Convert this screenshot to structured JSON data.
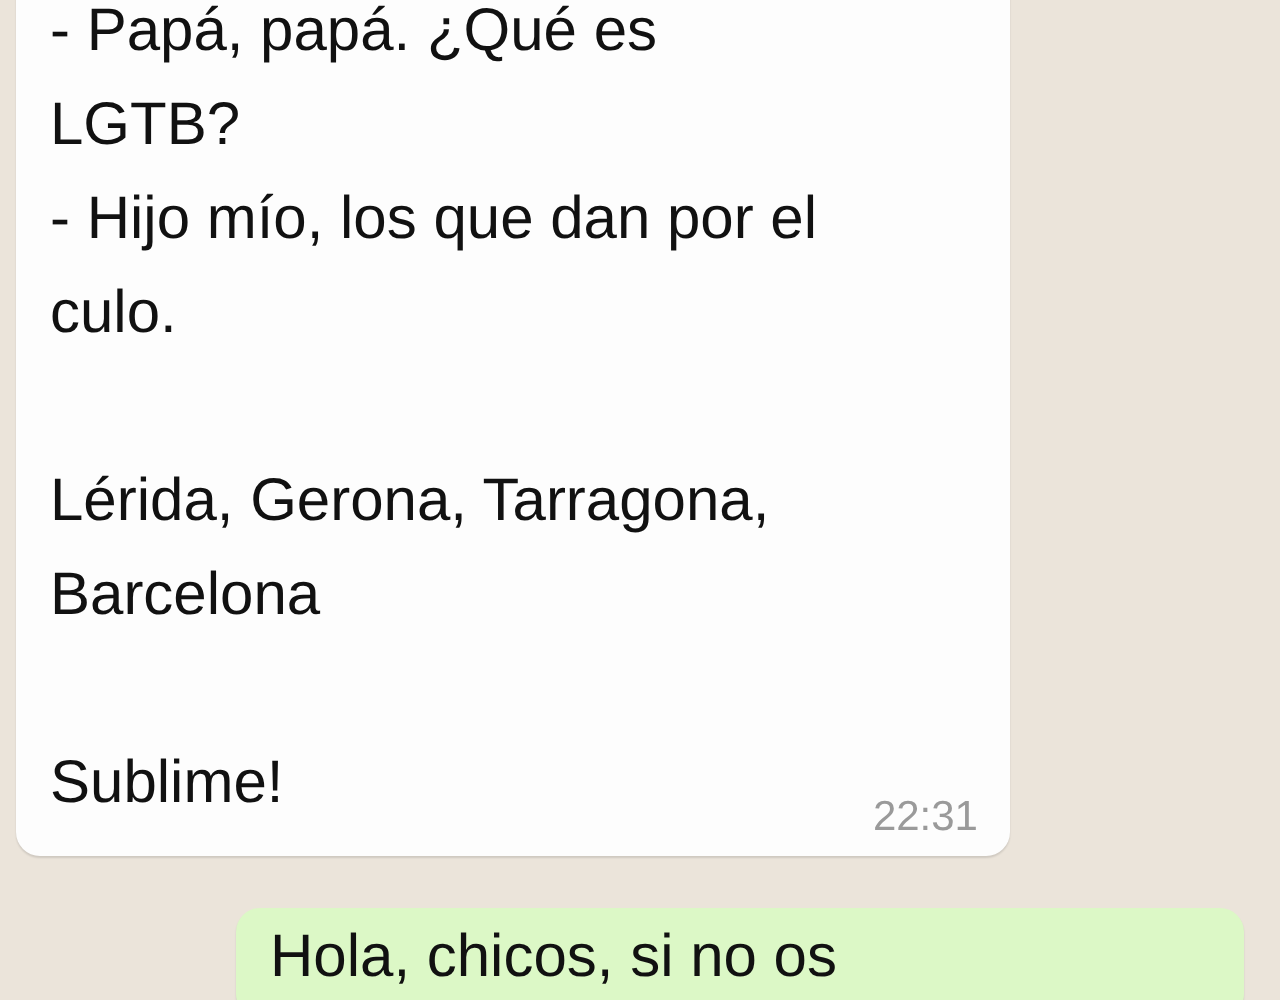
{
  "messages": [
    {
      "kind": "incoming",
      "paragraphs": [
        [
          "- Papá, papá. ¿Qué es",
          "LGTB?",
          "- Hijo mío, los que dan por el",
          "culo."
        ],
        [
          "Lérida, Gerona, Tarragona,",
          "Barcelona"
        ],
        [
          "Sublime!"
        ]
      ],
      "time": "22:31"
    },
    {
      "kind": "outgoing",
      "paragraphs": [
        [
          "Hola, chicos, si no os"
        ]
      ]
    }
  ]
}
